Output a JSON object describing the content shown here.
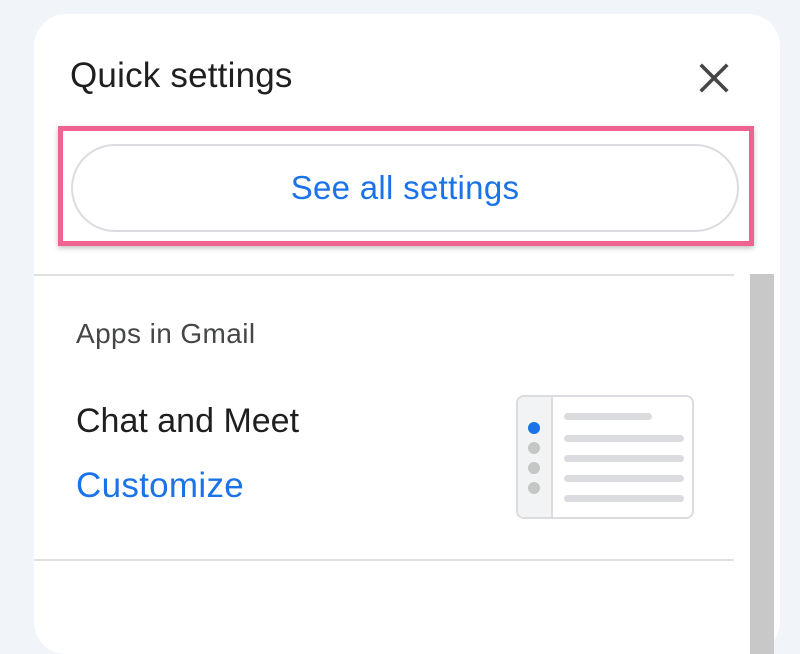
{
  "header": {
    "title": "Quick settings",
    "close_icon": "close-icon"
  },
  "primary_action": {
    "label": "See all settings"
  },
  "apps_section": {
    "heading": "Apps in Gmail",
    "item_title": "Chat and Meet",
    "link_label": "Customize",
    "illustration": "chat-meet-layout-illustration"
  },
  "colors": {
    "accent_blue": "#1a73e8",
    "highlight_pink": "#f0628f",
    "text_primary": "#1f1f1f",
    "text_secondary": "#444746",
    "background": "#f1f4f9"
  }
}
